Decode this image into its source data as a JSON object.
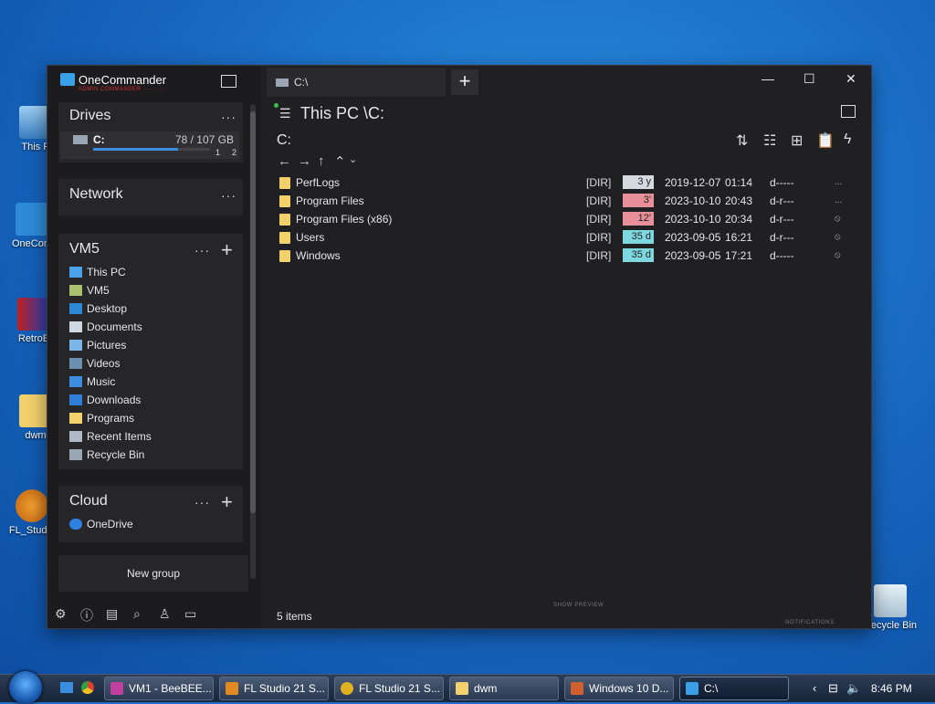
{
  "desktop": {
    "icons": [
      {
        "label": "This P"
      },
      {
        "label": "OneCom"
      },
      {
        "label": "RetroB"
      },
      {
        "label": "dwm"
      },
      {
        "label": "FL_Studio"
      },
      {
        "label": "Recycle Bin"
      }
    ]
  },
  "window": {
    "app_name": "OneCommander",
    "app_subtitle": "ADMIN COMMANDER · ···· ··· · ",
    "drives": {
      "title": "Drives",
      "menu": "···",
      "drive_label": "C:",
      "drive_usage": "78 / 107 GB",
      "usage_fraction": 0.73,
      "page_1": "1",
      "page_2": "2"
    },
    "network": {
      "title": "Network",
      "menu": "···"
    },
    "vm5": {
      "title": "VM5",
      "menu": "···",
      "add": "+",
      "items": [
        {
          "label": "This PC",
          "color": "#4aa3e8"
        },
        {
          "label": "VM5",
          "color": "#a8c070"
        },
        {
          "label": "Desktop",
          "color": "#2d89d6"
        },
        {
          "label": "Documents",
          "color": "#cfd8e0"
        },
        {
          "label": "Pictures",
          "color": "#7ab7e8"
        },
        {
          "label": "Videos",
          "color": "#6c8fb0"
        },
        {
          "label": "Music",
          "color": "#3d8ee0"
        },
        {
          "label": "Downloads",
          "color": "#2f7fd8"
        },
        {
          "label": "Programs",
          "color": "#f2d06b"
        },
        {
          "label": "Recent Items",
          "color": "#b0bac6"
        },
        {
          "label": "Recycle Bin",
          "color": "#9aa6b4"
        }
      ]
    },
    "cloud": {
      "title": "Cloud",
      "menu": "···",
      "add": "+",
      "items": [
        {
          "label": "OneDrive",
          "color": "#2d7fe0"
        }
      ]
    },
    "new_group": "New group",
    "tab": {
      "label": "C:\\"
    },
    "tab_add": "+",
    "path_title": "This PC \\C:",
    "drive_heading": "C:",
    "controls": {
      "minimize": "—",
      "maximize": "☐",
      "close": "✕"
    },
    "files": [
      {
        "name": "PerfLogs",
        "type": "[DIR]",
        "age": "3 y",
        "age_color": "#d8d8e0",
        "date": "2019-12-07",
        "time": "01:14",
        "attr": "d-----",
        "flag": "..."
      },
      {
        "name": "Program Files",
        "type": "[DIR]",
        "age": "3'",
        "age_color": "#e8909a",
        "date": "2023-10-10",
        "time": "20:43",
        "attr": "d-r---",
        "flag": "..."
      },
      {
        "name": "Program Files (x86)",
        "type": "[DIR]",
        "age": "12'",
        "age_color": "#e8909a",
        "date": "2023-10-10",
        "time": "20:34",
        "attr": "d-r---",
        "flag": "⦸"
      },
      {
        "name": "Users",
        "type": "[DIR]",
        "age": "35 d",
        "age_color": "#7ed8e0",
        "date": "2023-09-05",
        "time": "16:21",
        "attr": "d-r---",
        "flag": "⦸"
      },
      {
        "name": "Windows",
        "type": "[DIR]",
        "age": "35 d",
        "age_color": "#7ed8e0",
        "date": "2023-09-05",
        "time": "17:21",
        "attr": "d-----",
        "flag": "⦸"
      }
    ],
    "status": "5 items",
    "show_preview": "SHOW PREVIEW",
    "notifications": "NOTIFICATIONS"
  },
  "taskbar": {
    "buttons": [
      {
        "label": "VM1 - BeeBEE...",
        "color": "#c040a0"
      },
      {
        "label": "FL Studio 21 S...",
        "color": "#e08a20"
      },
      {
        "label": "FL Studio 21 S...",
        "color": "#e0b020"
      },
      {
        "label": "dwm",
        "color": "#f2d06b"
      },
      {
        "label": "Windows 10 D...",
        "color": "#d06030"
      },
      {
        "label": "C:\\",
        "color": "#3aa0e8"
      }
    ],
    "clock": "8:46 PM"
  }
}
